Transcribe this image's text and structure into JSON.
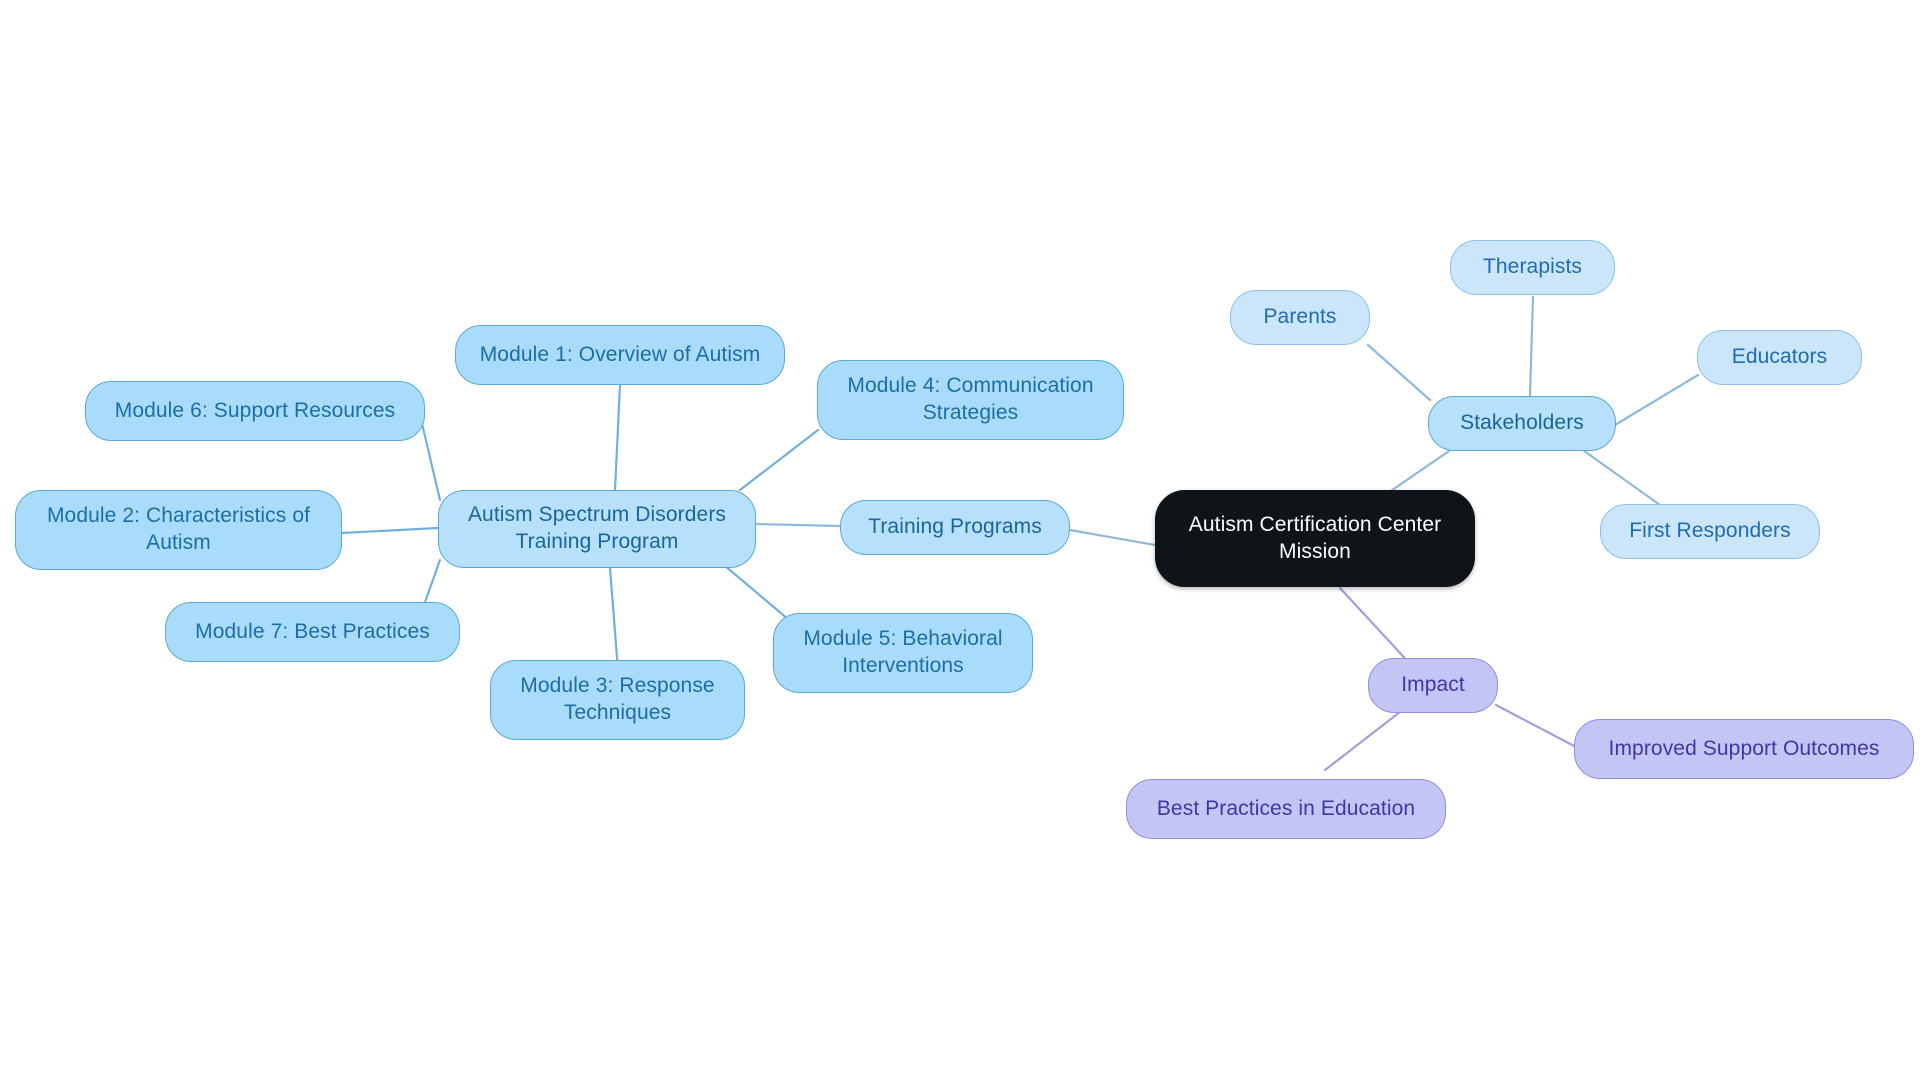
{
  "diagram": {
    "title": "Autism Certification Center Mission",
    "type": "mind-map",
    "background_color": "#ffffff",
    "palette": {
      "root_fill": "#0f1419",
      "root_text": "#ffffff",
      "blue_fill": "#a9dcfb",
      "blue_border": "#5aa9d6",
      "blue_text": "#1c6ea4",
      "light_blue_fill": "#cbe5fb",
      "light_blue_border": "#8fc0e4",
      "light_blue_text": "#1f6cb0",
      "purple_fill": "#c5c5f5",
      "purple_border": "#8f8fdb",
      "purple_text": "#3b39a8",
      "edge_blue": "#8fb8dd",
      "edge_purple": "#9f9ede"
    }
  },
  "nodes": {
    "root": {
      "label": "Autism Certification Center\nMission"
    },
    "training_programs": {
      "label": "Training Programs"
    },
    "program": {
      "label": "Autism Spectrum Disorders\nTraining Program"
    },
    "module1": {
      "label": "Module 1: Overview of Autism"
    },
    "module2": {
      "label": "Module 2: Characteristics of\nAutism"
    },
    "module3": {
      "label": "Module 3: Response\nTechniques"
    },
    "module4": {
      "label": "Module 4: Communication\nStrategies"
    },
    "module5": {
      "label": "Module 5: Behavioral\nInterventions"
    },
    "module6": {
      "label": "Module 6: Support Resources"
    },
    "module7": {
      "label": "Module 7: Best Practices"
    },
    "stakeholders": {
      "label": "Stakeholders"
    },
    "parents": {
      "label": "Parents"
    },
    "therapists": {
      "label": "Therapists"
    },
    "educators": {
      "label": "Educators"
    },
    "first_responders": {
      "label": "First Responders"
    },
    "impact": {
      "label": "Impact"
    },
    "best_practices_education": {
      "label": "Best Practices in Education"
    },
    "improved_support_outcomes": {
      "label": "Improved Support Outcomes"
    }
  },
  "chart_data": {
    "type": "diagram",
    "title": "Autism Certification Center Mission",
    "root": "Autism Certification Center Mission",
    "branches": [
      {
        "name": "Training Programs",
        "color": "blue",
        "children": [
          {
            "name": "Autism Spectrum Disorders Training Program",
            "children": [
              "Module 1: Overview of Autism",
              "Module 2: Characteristics of Autism",
              "Module 3: Response Techniques",
              "Module 4: Communication Strategies",
              "Module 5: Behavioral Interventions",
              "Module 6: Support Resources",
              "Module 7: Best Practices"
            ]
          }
        ]
      },
      {
        "name": "Stakeholders",
        "color": "blue",
        "children": [
          "Parents",
          "Therapists",
          "Educators",
          "First Responders"
        ]
      },
      {
        "name": "Impact",
        "color": "purple",
        "children": [
          "Best Practices in Education",
          "Improved Support Outcomes"
        ]
      }
    ],
    "edges": [
      [
        "Autism Certification Center Mission",
        "Training Programs"
      ],
      [
        "Autism Certification Center Mission",
        "Stakeholders"
      ],
      [
        "Autism Certification Center Mission",
        "Impact"
      ],
      [
        "Training Programs",
        "Autism Spectrum Disorders Training Program"
      ],
      [
        "Autism Spectrum Disorders Training Program",
        "Module 1: Overview of Autism"
      ],
      [
        "Autism Spectrum Disorders Training Program",
        "Module 2: Characteristics of Autism"
      ],
      [
        "Autism Spectrum Disorders Training Program",
        "Module 3: Response Techniques"
      ],
      [
        "Autism Spectrum Disorders Training Program",
        "Module 4: Communication Strategies"
      ],
      [
        "Autism Spectrum Disorders Training Program",
        "Module 5: Behavioral Interventions"
      ],
      [
        "Autism Spectrum Disorders Training Program",
        "Module 6: Support Resources"
      ],
      [
        "Autism Spectrum Disorders Training Program",
        "Module 7: Best Practices"
      ],
      [
        "Stakeholders",
        "Parents"
      ],
      [
        "Stakeholders",
        "Therapists"
      ],
      [
        "Stakeholders",
        "Educators"
      ],
      [
        "Stakeholders",
        "First Responders"
      ],
      [
        "Impact",
        "Best Practices in Education"
      ],
      [
        "Impact",
        "Improved Support Outcomes"
      ]
    ]
  }
}
